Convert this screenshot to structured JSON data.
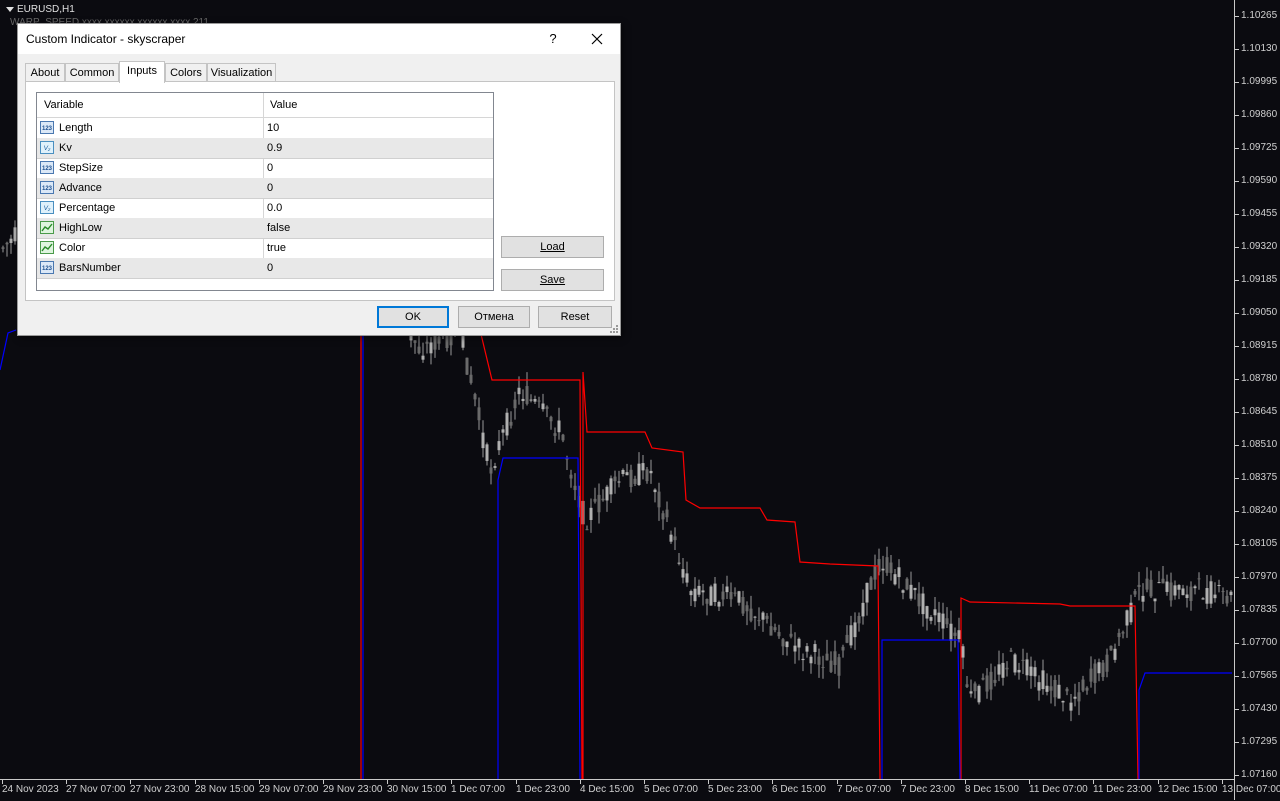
{
  "chart": {
    "symbol": "EURUSD,H1",
    "indicator_label": "WARP_SPEED xxxx xxxxxx xxxxxx xxxx 211",
    "price_ticks": [
      "1.10265",
      "1.10130",
      "1.09995",
      "1.09860",
      "1.09725",
      "1.09590",
      "1.09455",
      "1.09320",
      "1.09185",
      "1.09050",
      "1.08915",
      "1.08780",
      "1.08645",
      "1.08510",
      "1.08375",
      "1.08240",
      "1.08105",
      "1.07970",
      "1.07835",
      "1.07700",
      "1.07565",
      "1.07430",
      "1.07295",
      "1.07160"
    ],
    "time_ticks": [
      "24 Nov 2023",
      "27 Nov 07:00",
      "27 Nov 23:00",
      "28 Nov 15:00",
      "29 Nov 07:00",
      "29 Nov 23:00",
      "30 Nov 15:00",
      "1 Dec 07:00",
      "1 Dec 23:00",
      "4 Dec 15:00",
      "5 Dec 07:00",
      "5 Dec 23:00",
      "6 Dec 15:00",
      "7 Dec 07:00",
      "7 Dec 23:00",
      "8 Dec 15:00",
      "11 Dec 07:00",
      "11 Dec 23:00",
      "12 Dec 15:00",
      "13 Dec 07:00"
    ],
    "colors": {
      "background": "#0b0b10",
      "candles": "#9a9a9a",
      "upper_line": "#ff0000",
      "lower_line": "#0000ff",
      "axis_text": "#d0d0d0"
    }
  },
  "dialog": {
    "title": "Custom Indicator - skyscraper",
    "help_label": "?",
    "tabs": [
      {
        "label": "About"
      },
      {
        "label": "Common"
      },
      {
        "label": "Inputs",
        "active": true
      },
      {
        "label": "Colors"
      },
      {
        "label": "Visualization"
      }
    ],
    "grid": {
      "headers": {
        "variable": "Variable",
        "value": "Value"
      },
      "rows": [
        {
          "variable": "Length",
          "value": "10",
          "type": "int-icon"
        },
        {
          "variable": "Kv",
          "value": "0.9",
          "type": "double-icon"
        },
        {
          "variable": "StepSize",
          "value": "0",
          "type": "int-icon"
        },
        {
          "variable": "Advance",
          "value": "0",
          "type": "int-icon"
        },
        {
          "variable": "Percentage",
          "value": "0.0",
          "type": "double-icon"
        },
        {
          "variable": "HighLow",
          "value": "false",
          "type": "bool-icon"
        },
        {
          "variable": "Color",
          "value": "true",
          "type": "bool-icon"
        },
        {
          "variable": "BarsNumber",
          "value": "0",
          "type": "int-icon"
        }
      ]
    },
    "buttons": {
      "load": "Load",
      "save": "Save",
      "ok": "OK",
      "cancel": "Отмена",
      "reset": "Reset"
    }
  }
}
